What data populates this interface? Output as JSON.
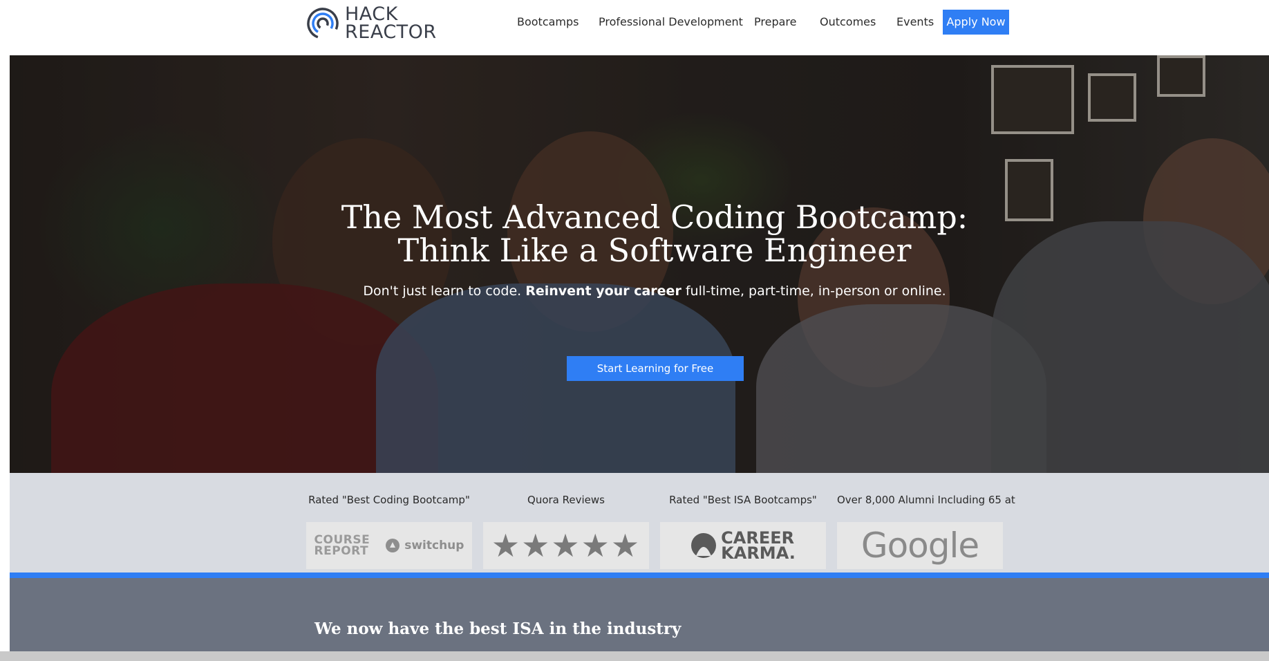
{
  "header": {
    "logo_line1": "HACK",
    "logo_line2": "REACTOR",
    "nav": [
      "Bootcamps",
      "Professional Development",
      "Prepare",
      "Outcomes",
      "Events"
    ],
    "apply_label": "Apply Now"
  },
  "hero": {
    "title_line1": "The Most Advanced Coding Bootcamp:",
    "title_line2": "Think Like a Software Engineer",
    "subtitle_pre": "Don't just learn to code. ",
    "subtitle_bold": "Reinvent your career",
    "subtitle_post": " full-time, part-time, in-person or online.",
    "cta_label": "Start Learning for Free"
  },
  "ratings": [
    {
      "label": "Rated \"Best Coding Bootcamp\"",
      "logo_a_line1": "COURSE",
      "logo_a_line2": "REPORT",
      "logo_b": "switchup"
    },
    {
      "label": "Quora Reviews",
      "stars": "★★★★★"
    },
    {
      "label": "Rated \"Best ISA Bootcamps\"",
      "logo_line1": "CAREER",
      "logo_line2": "KARMA."
    },
    {
      "label": "Over 8,000 Alumni Including 65 at",
      "logo": "Google"
    }
  ],
  "isa": {
    "title": "We now have the best ISA in the industry"
  },
  "colors": {
    "accent": "#2f7ef4",
    "band": "#d8dbe1",
    "dark_band": "#6b7280"
  }
}
